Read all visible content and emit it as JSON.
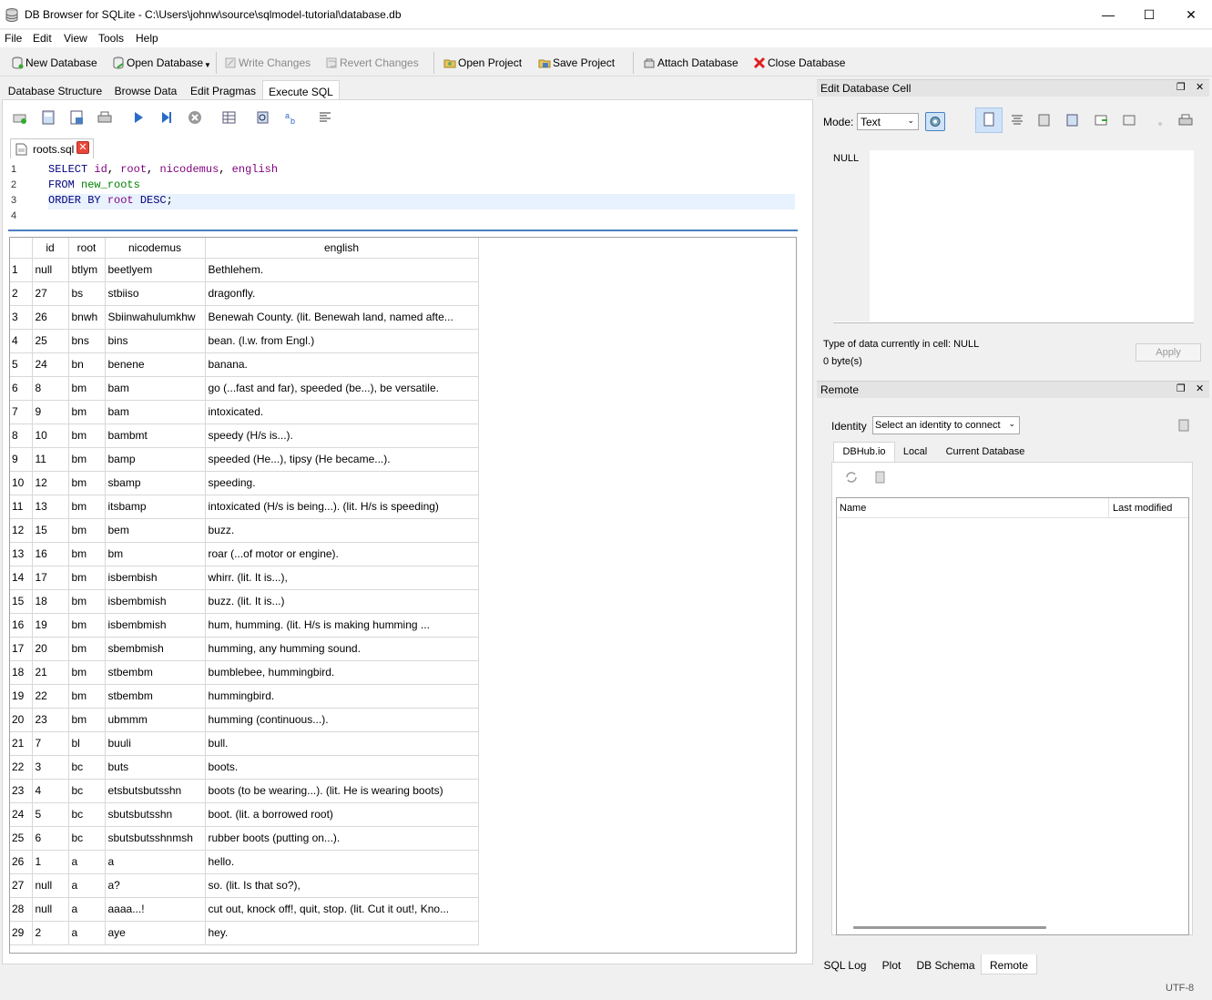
{
  "window": {
    "title": "DB Browser for SQLite - C:\\Users\\johnw\\source\\sqlmodel-tutorial\\database.db",
    "minimize": "—",
    "maximize": "☐",
    "close": "✕"
  },
  "menu": [
    "File",
    "Edit",
    "View",
    "Tools",
    "Help"
  ],
  "toolbar": {
    "new_database": "New Database",
    "open_database": "Open Database",
    "write_changes": "Write Changes",
    "revert_changes": "Revert Changes",
    "open_project": "Open Project",
    "save_project": "Save Project",
    "attach_database": "Attach Database",
    "close_database": "Close Database"
  },
  "tabs": [
    "Database Structure",
    "Browse Data",
    "Edit Pragmas",
    "Execute SQL"
  ],
  "file_tab": {
    "name": "roots.sql",
    "close": "✕"
  },
  "editor": {
    "line_numbers": [
      "1",
      "2",
      "3",
      "4"
    ]
  },
  "results": {
    "columns": [
      "id",
      "root",
      "nicodemus",
      "english"
    ],
    "rows": [
      [
        "1",
        "null",
        "btlym",
        "beetlyem",
        "Bethlehem."
      ],
      [
        "2",
        "27",
        "bs",
        "stbiiso",
        "dragonfly."
      ],
      [
        "3",
        "26",
        "bnwh",
        "Sbiinwahulumkhw",
        "Benewah County. (lit. Benewah land, named afte..."
      ],
      [
        "4",
        "25",
        "bns",
        "bins",
        "bean. (l.w. from Engl.)"
      ],
      [
        "5",
        "24",
        "bn",
        "benene",
        "banana."
      ],
      [
        "6",
        "8",
        "bm",
        "bam",
        "go (...fast and far), speeded (be...), be versatile."
      ],
      [
        "7",
        "9",
        "bm",
        "bam",
        "intoxicated."
      ],
      [
        "8",
        "10",
        "bm",
        "bambmt",
        "speedy (H/s is...)."
      ],
      [
        "9",
        "11",
        "bm",
        "bamp",
        "speeded (He...), tipsy (He became...)."
      ],
      [
        "10",
        "12",
        "bm",
        "sbamp",
        "speeding."
      ],
      [
        "11",
        "13",
        "bm",
        "itsbamp",
        "intoxicated (H/s is being...). (lit. H/s is speeding)"
      ],
      [
        "12",
        "15",
        "bm",
        "bem",
        "buzz."
      ],
      [
        "13",
        "16",
        "bm",
        "bm",
        "roar (...of motor or engine)."
      ],
      [
        "14",
        "17",
        "bm",
        "isbembish",
        "whirr. (lit. It is...),"
      ],
      [
        "15",
        "18",
        "bm",
        "isbembmish",
        "buzz. (lit. It is...)"
      ],
      [
        "16",
        "19",
        "bm",
        "isbembmish",
        "hum, humming. (lit. H/s is making humming ..."
      ],
      [
        "17",
        "20",
        "bm",
        "sbembmish",
        "humming, any humming sound."
      ],
      [
        "18",
        "21",
        "bm",
        "stbembm",
        "bumblebee, hummingbird."
      ],
      [
        "19",
        "22",
        "bm",
        "stbembm",
        "hummingbird."
      ],
      [
        "20",
        "23",
        "bm",
        "ubmmm",
        "humming (continuous...)."
      ],
      [
        "21",
        "7",
        "bl",
        "buuli",
        "bull."
      ],
      [
        "22",
        "3",
        "bc",
        "buts",
        "boots."
      ],
      [
        "23",
        "4",
        "bc",
        "etsbutsbutsshn",
        "boots (to be wearing...). (lit. He is wearing boots)"
      ],
      [
        "24",
        "5",
        "bc",
        "sbutsbutsshn",
        "boot. (lit. a borrowed root)"
      ],
      [
        "25",
        "6",
        "bc",
        "sbutsbutsshnmsh",
        "rubber boots (putting on...)."
      ],
      [
        "26",
        "1",
        "a",
        "a",
        "hello."
      ],
      [
        "27",
        "null",
        "a",
        "a?",
        "so. (lit. Is that so?),"
      ],
      [
        "28",
        "null",
        "a",
        "aaaa...!",
        "cut out, knock off!, quit, stop. (lit. Cut it out!, Kno..."
      ],
      [
        "29",
        "2",
        "a",
        "aye",
        "hey."
      ]
    ]
  },
  "cell_editor": {
    "title": "Edit Database Cell",
    "mode_label": "Mode:",
    "mode_value": "Text",
    "content": "NULL",
    "type_info": "Type of data currently in cell: NULL",
    "size_info": "0 byte(s)",
    "apply": "Apply"
  },
  "remote": {
    "title": "Remote",
    "identity_label": "Identity",
    "identity_value": "Select an identity to connect",
    "tabs": [
      "DBHub.io",
      "Local",
      "Current Database"
    ],
    "col_name": "Name",
    "col_modified": "Last modified"
  },
  "bottom_tabs": [
    "SQL Log",
    "Plot",
    "DB Schema",
    "Remote"
  ],
  "status": {
    "encoding": "UTF-8"
  },
  "colors": {
    "accent": "#4a7fc1",
    "close_red": "#e8473a",
    "keyword": "#00007f",
    "identifier": "#7f007f",
    "table": "#008000"
  }
}
